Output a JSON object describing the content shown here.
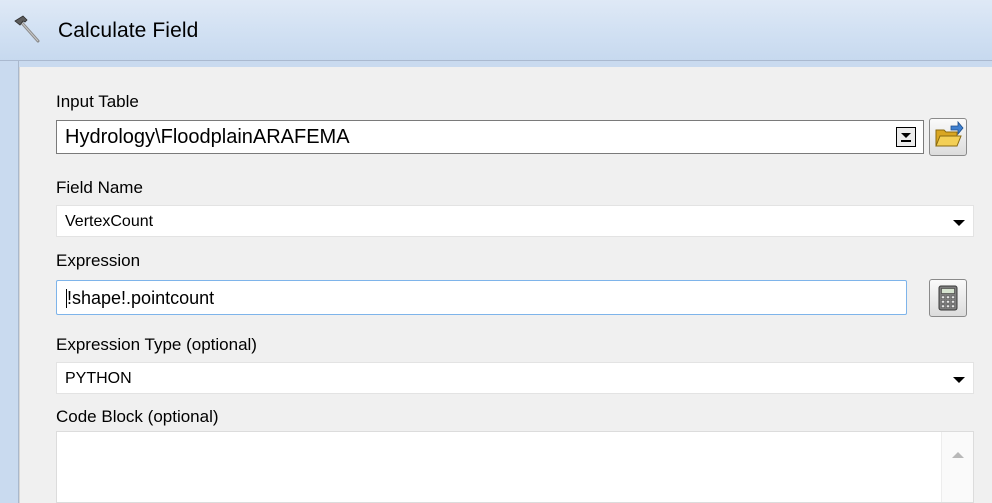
{
  "window": {
    "title": "Calculate Field",
    "title_icon": "hammer-icon"
  },
  "form": {
    "input_table": {
      "label": "Input Table",
      "value": "Hydrology\\FloodplainARAFEMA",
      "browse_icon": "folder-open-icon"
    },
    "field_name": {
      "label": "Field Name",
      "value": "VertexCount"
    },
    "expression": {
      "label": "Expression",
      "value": "!shape!.pointcount",
      "builder_icon": "calculator-icon"
    },
    "expression_type": {
      "label": "Expression Type (optional)",
      "value": "PYTHON"
    },
    "code_block": {
      "label": "Code Block (optional)",
      "value": ""
    }
  },
  "colors": {
    "titlebar": "#d2e1f3",
    "panel": "#f0f0f0",
    "focus_border": "#7eb4ea"
  }
}
